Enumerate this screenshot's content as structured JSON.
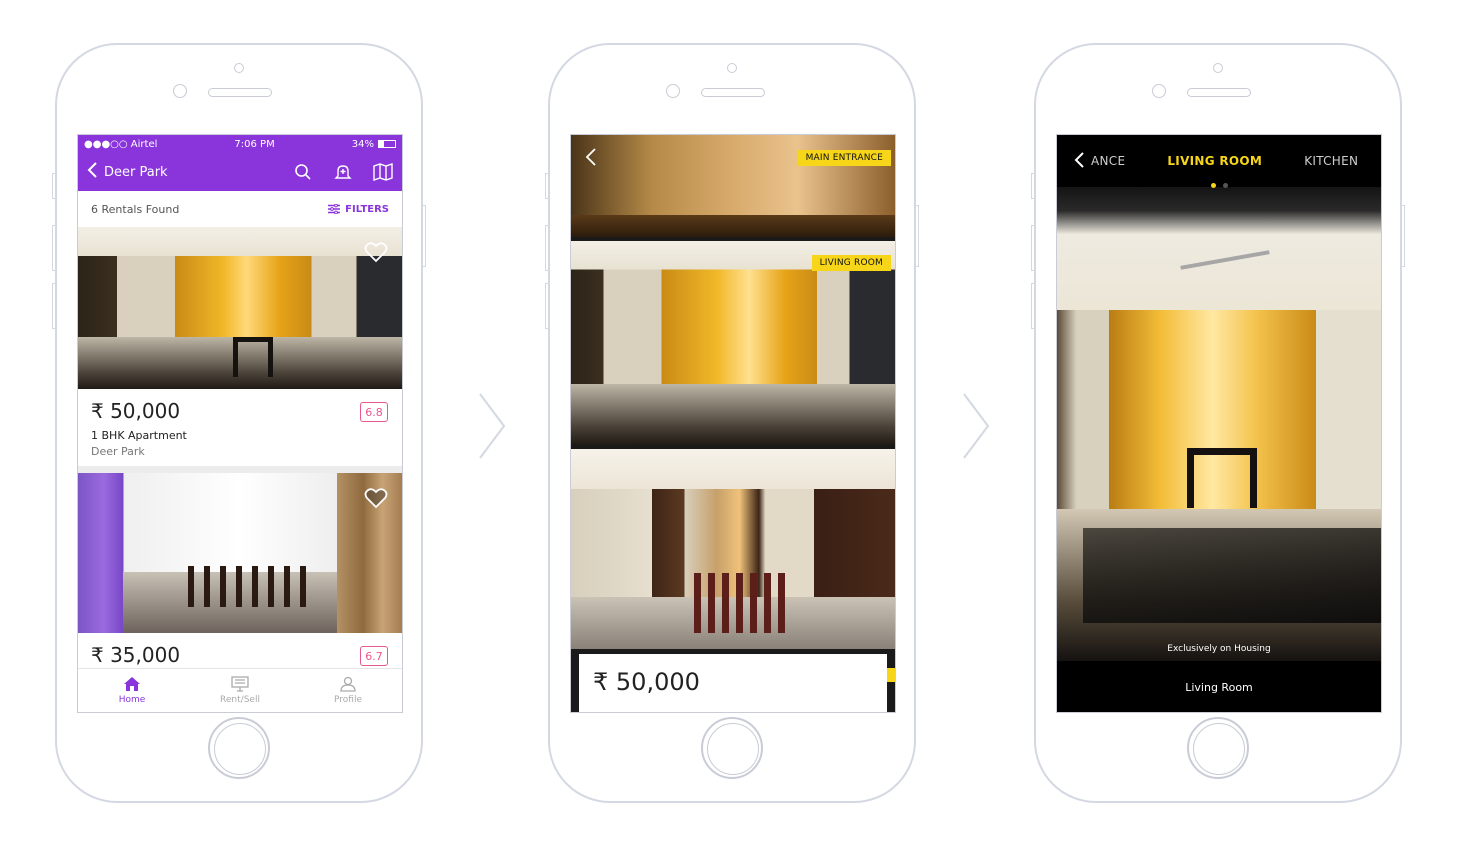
{
  "colors": {
    "accent": "#8a35db",
    "tag_yellow": "#f7d619",
    "score_pink": "#e8578d"
  },
  "screen1": {
    "status": {
      "carrier": "●●●○○ Airtel",
      "time": "7:06 PM",
      "battery": "34%"
    },
    "nav": {
      "title": "Deer Park"
    },
    "results": {
      "count": "6 Rentals Found",
      "filters": "FILTERS"
    },
    "listings": [
      {
        "price": "₹ 50,000",
        "type": "1 BHK Apartment",
        "location": "Deer Park",
        "score": "6.8"
      },
      {
        "price": "₹ 35,000",
        "score": "6.7"
      }
    ],
    "tabs": [
      {
        "label": "Home",
        "icon": "home-icon"
      },
      {
        "label": "Rent/Sell",
        "icon": "rent-sell-icon"
      },
      {
        "label": "Profile",
        "icon": "profile-icon"
      }
    ]
  },
  "screen2": {
    "tags": {
      "entrance": "MAIN ENTRANCE",
      "living": "LIVING ROOM"
    },
    "price": "₹ 50,000"
  },
  "screen3": {
    "tabs": {
      "prev": "ANCE",
      "active": "LIVING ROOM",
      "next": "KITCHEN"
    },
    "watermark": "Exclusively on Housing",
    "caption": "Living Room"
  }
}
